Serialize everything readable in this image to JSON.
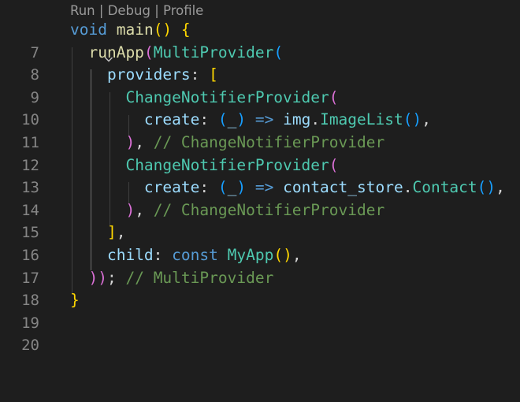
{
  "codelens": {
    "run": "Run",
    "debug": "Debug",
    "profile": "Profile",
    "separator": " | "
  },
  "lines": [
    {
      "n": "7",
      "t": [
        "void",
        " ",
        "main",
        "()",
        " ",
        "{"
      ]
    },
    {
      "n": "8",
      "t": [
        "  ",
        "runApp",
        "(",
        "MultiProvider",
        "("
      ]
    },
    {
      "n": "9",
      "t": [
        "    ",
        "providers",
        ":",
        " ",
        "["
      ]
    },
    {
      "n": "10",
      "t": [
        "      ",
        "ChangeNotifierProvider",
        "("
      ]
    },
    {
      "n": "11",
      "t": [
        "        ",
        "create",
        ":",
        " ",
        "(",
        "_",
        ")",
        " => ",
        "img",
        ".",
        "ImageList",
        "()",
        ","
      ]
    },
    {
      "n": "12",
      "t": [
        "      ",
        ")",
        ",",
        " ",
        "// ChangeNotifierProvider"
      ]
    },
    {
      "n": "13",
      "t": [
        "      ",
        "ChangeNotifierProvider",
        "("
      ]
    },
    {
      "n": "14",
      "t": [
        "        ",
        "create",
        ":",
        " ",
        "(",
        "_",
        ")",
        " => ",
        "contact_store",
        ".",
        "Contact",
        "()",
        ","
      ]
    },
    {
      "n": "15",
      "t": [
        "      ",
        ")",
        ",",
        " ",
        "// ChangeNotifierProvider"
      ]
    },
    {
      "n": "16",
      "t": [
        "    ",
        "]",
        ","
      ]
    },
    {
      "n": "17",
      "t": [
        "    ",
        "child",
        ":",
        " ",
        "const",
        " ",
        "MyApp",
        "()",
        ","
      ]
    },
    {
      "n": "18",
      "t": [
        "  ",
        "))",
        ";",
        " ",
        "// MultiProvider"
      ]
    },
    {
      "n": "19",
      "t": [
        "}"
      ]
    },
    {
      "n": "20",
      "t": [
        ""
      ]
    }
  ],
  "theme": {
    "background": "#1e1e1e",
    "keyword": "#569cd6",
    "function": "#dcdcaa",
    "type": "#4ec9b0",
    "variable": "#9cdcfe",
    "comment": "#6a9955",
    "bracket_level1": "#ffd700",
    "bracket_level2": "#da70d6",
    "bracket_level3": "#179fff"
  },
  "icons": {
    "fold": "chevron-down-icon"
  }
}
